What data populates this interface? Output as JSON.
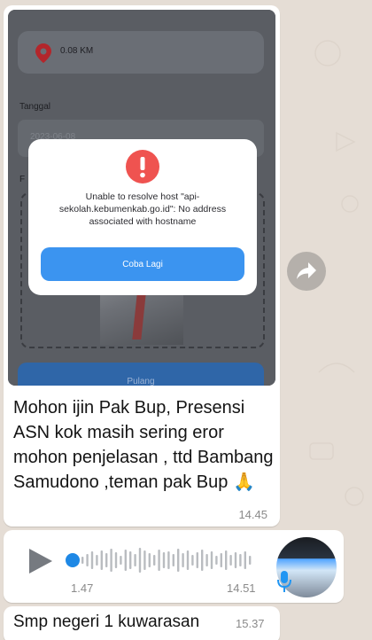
{
  "image_message": {
    "location": {
      "icon": "location-pin-icon",
      "distance": "0.08 KM"
    },
    "date_label": "Tanggal",
    "date_value": "2023-06-08",
    "photo_label": "F",
    "pulang_button": "Pulang",
    "error_dialog": {
      "icon": "error-icon",
      "message": "Unable to resolve host \"api-sekolah.kebumenkab.go.id\": No address associated with hostname",
      "retry_button": "Coba Lagi"
    },
    "caption": "Mohon ijin Pak Bup, Presensi ASN kok masih sering eror mohon penjelasan , ttd Bambang Samudono ,teman pak Bup 🙏",
    "time": "14.45",
    "forward_icon": "forward-arrow-icon"
  },
  "voice_message": {
    "play_icon": "play-icon",
    "duration": "1.47",
    "time": "14.51",
    "mic_icon": "microphone-icon"
  },
  "text_message": {
    "text": "Smp negeri 1 kuwarasan",
    "time": "15.37"
  },
  "colors": {
    "chat_background": "#e5ddd5",
    "bubble": "#ffffff",
    "accent_blue": "#3b94f0",
    "error_red": "#ef5350"
  }
}
